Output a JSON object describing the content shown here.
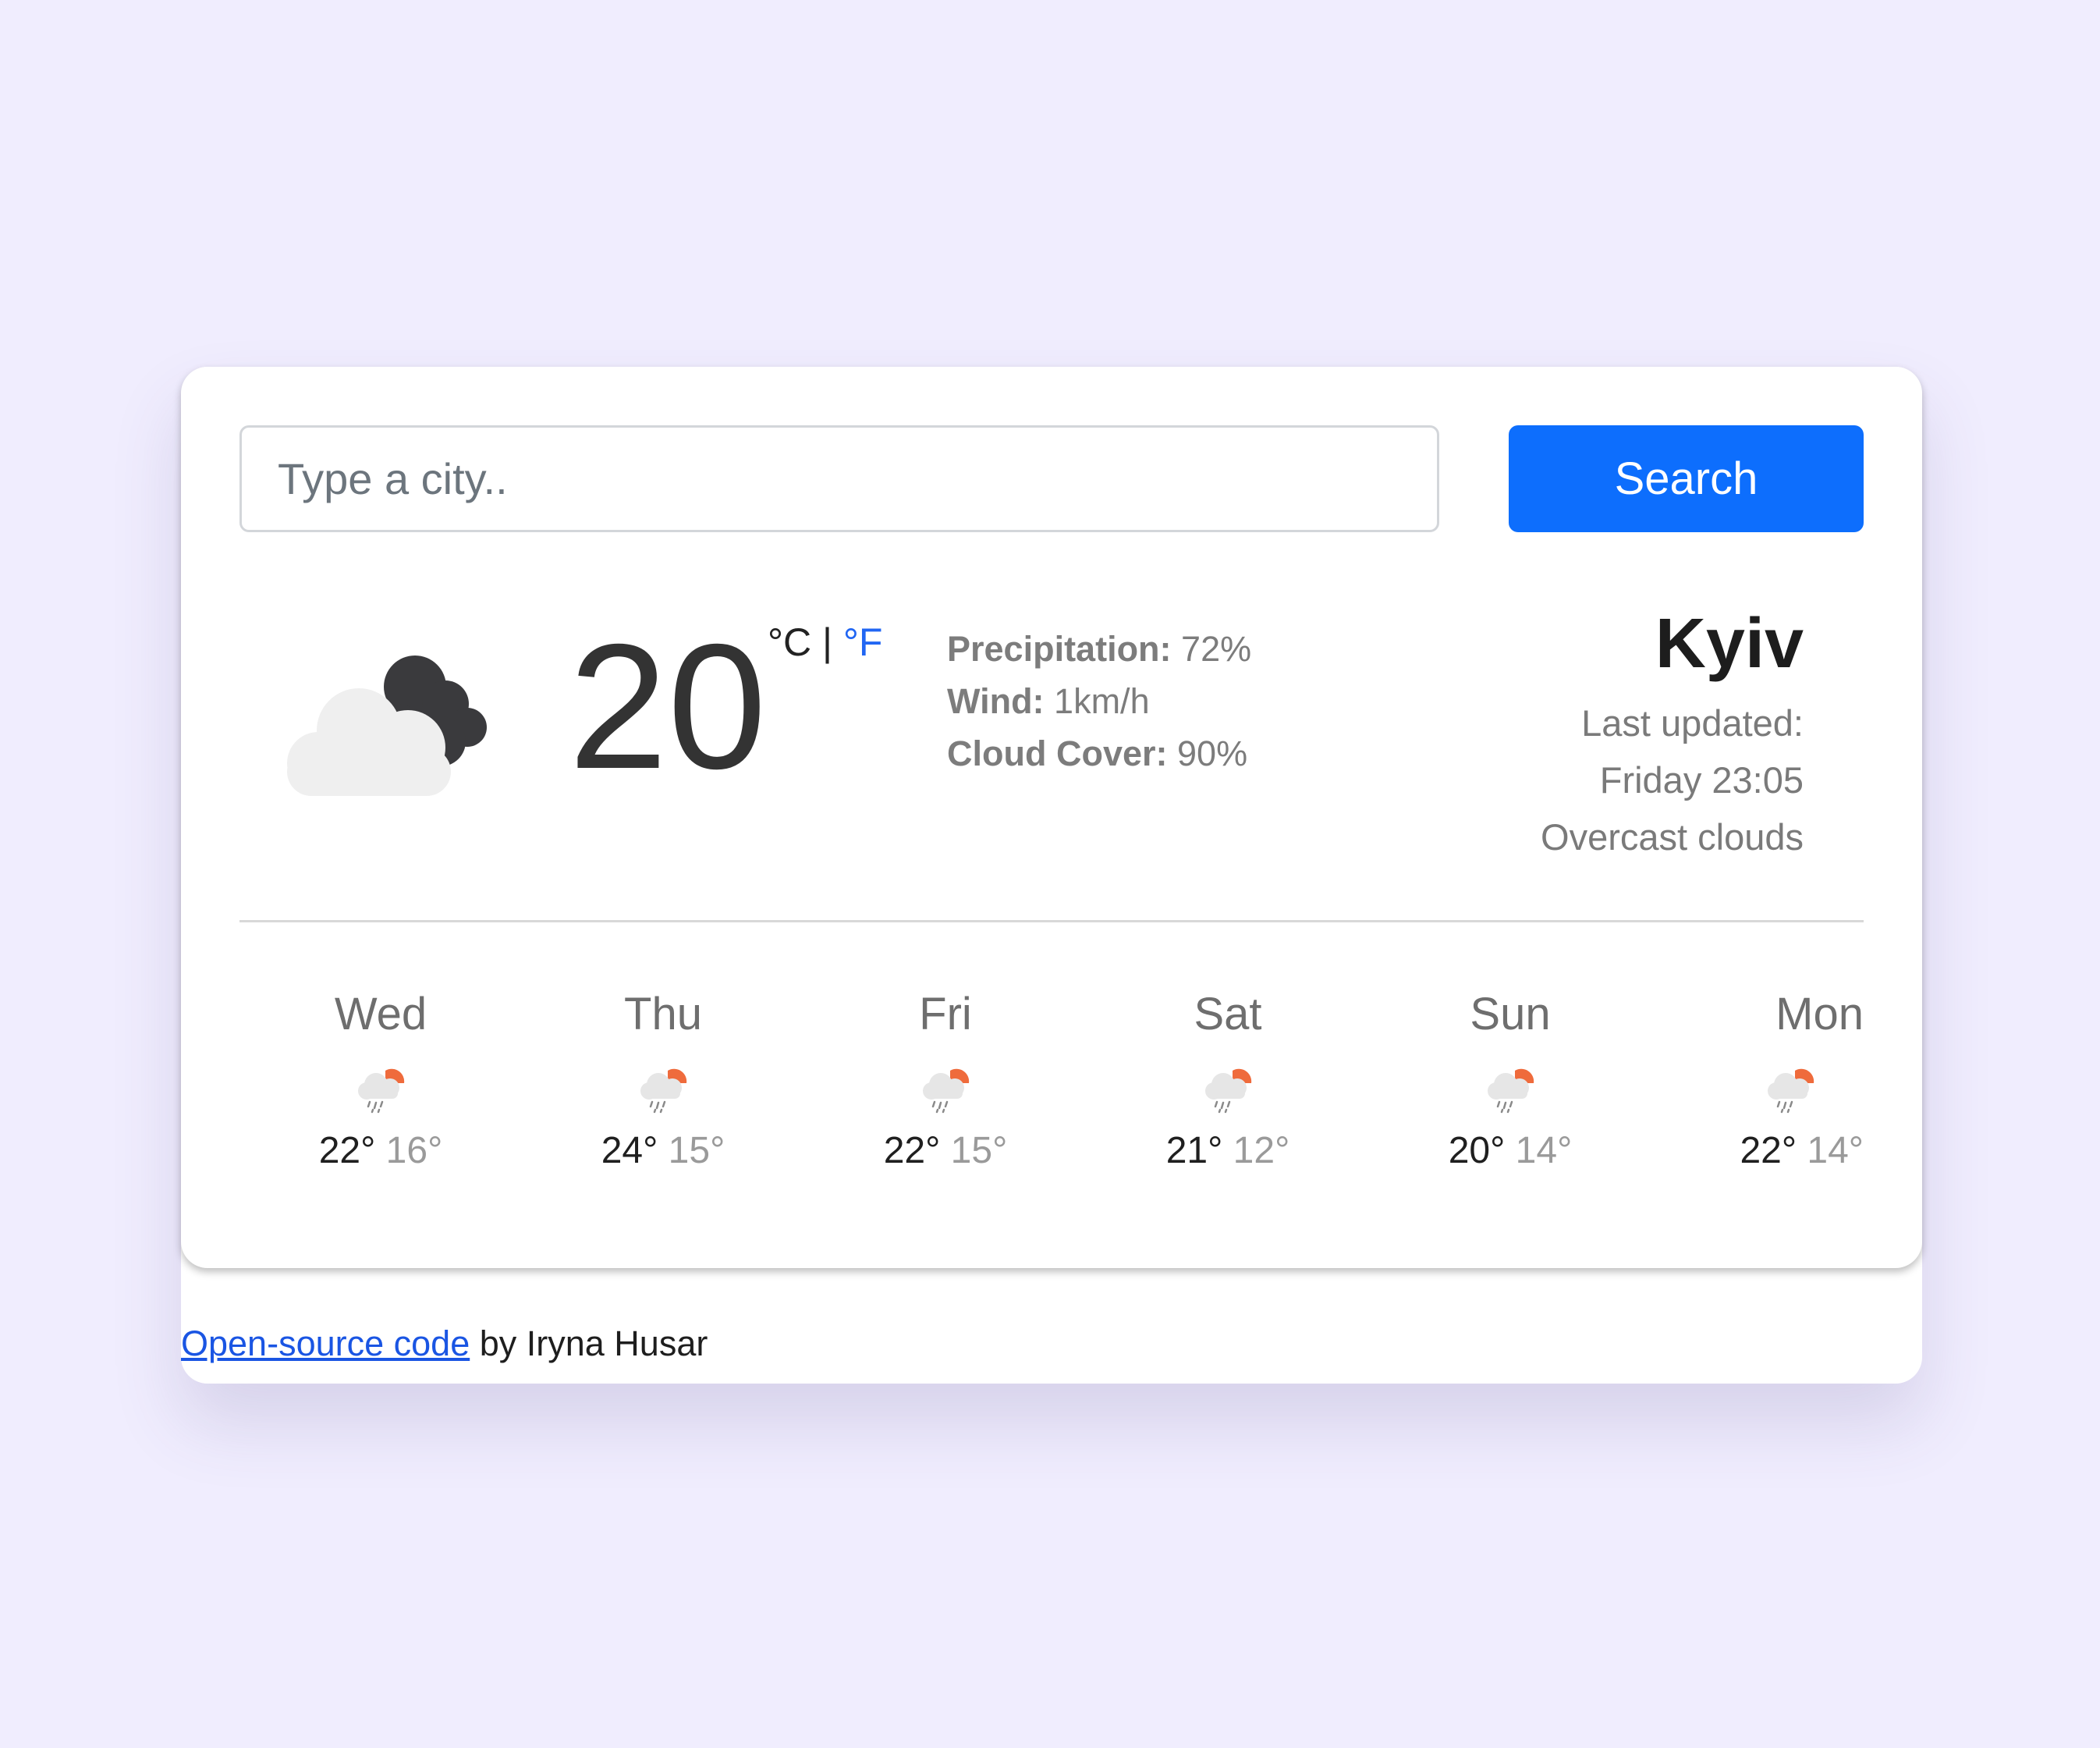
{
  "search": {
    "placeholder": "Type a city..",
    "value": "",
    "button_label": "Search"
  },
  "current": {
    "icon": "overcast-clouds-icon",
    "temperature": "20",
    "unit_celsius": "°C",
    "unit_separator": " | ",
    "unit_fahrenheit": "°F",
    "precipitation_label": "Precipitation:",
    "precipitation_value": " 72%",
    "wind_label": "Wind:",
    "wind_value": " 1km/h",
    "cloud_label": "Cloud Cover:",
    "cloud_value": " 90%"
  },
  "location": {
    "city": "Kyiv",
    "last_updated_label": "Last updated:",
    "last_updated_value": "Friday 23:05",
    "description": "Overcast clouds"
  },
  "forecast": [
    {
      "day": "Wed",
      "icon": "rain-sun-icon",
      "max": "22°",
      "min": "16°"
    },
    {
      "day": "Thu",
      "icon": "rain-sun-icon",
      "max": "24°",
      "min": "15°"
    },
    {
      "day": "Fri",
      "icon": "rain-sun-icon",
      "max": "22°",
      "min": "15°"
    },
    {
      "day": "Sat",
      "icon": "rain-sun-icon",
      "max": "21°",
      "min": "12°"
    },
    {
      "day": "Sun",
      "icon": "rain-sun-icon",
      "max": "20°",
      "min": "14°"
    },
    {
      "day": "Mon",
      "icon": "rain-sun-icon",
      "max": "22°",
      "min": "14°"
    }
  ],
  "footer": {
    "link_text": "Open-source code",
    "suffix": " by Iryna Husar"
  },
  "colors": {
    "page_background": "#f0edfe",
    "accent_blue": "#0d6efd",
    "link_blue": "#1a55e3",
    "sun_orange": "#ef6b3c"
  }
}
